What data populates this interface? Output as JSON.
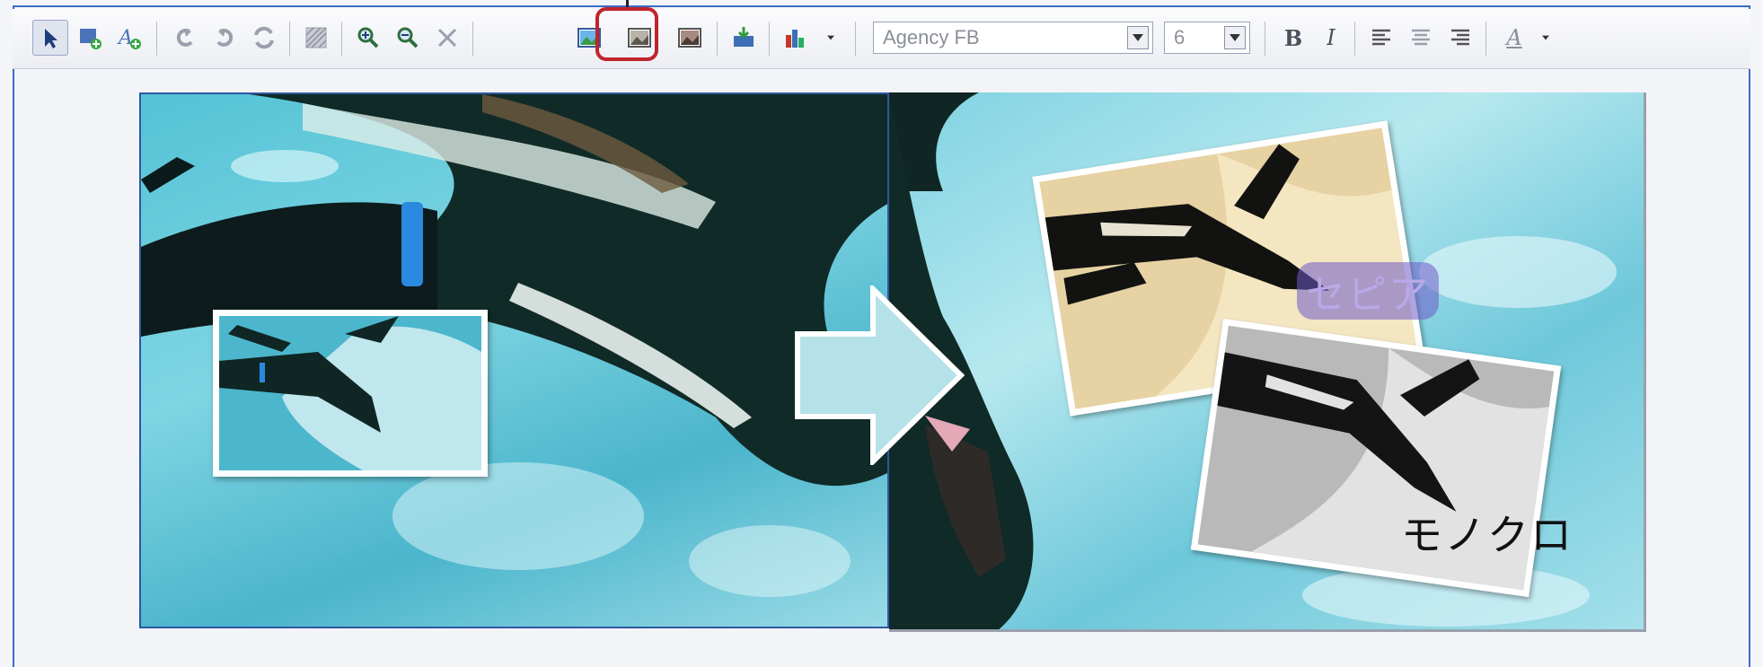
{
  "toolbar": {
    "font_name": "Agency FB",
    "font_size": "6",
    "bold_label": "B",
    "italic_label": "I",
    "font_color_label": "A",
    "icons": [
      "pointer-icon",
      "insert-image-icon",
      "insert-text-icon",
      "undo-icon",
      "redo-icon",
      "refresh-icon",
      "hatch-icon",
      "zoom-in-icon",
      "zoom-out-icon",
      "fit-icon",
      "color-image-icon",
      "sepia-image-icon",
      "mono-image-icon",
      "import-icon",
      "chart-icon",
      "align-left-icon",
      "align-center-icon",
      "align-right-icon"
    ]
  },
  "canvas": {
    "sepia_label": "セピア",
    "mono_label": "モノクロ"
  },
  "colors": {
    "highlight": "#c0242b",
    "frame_border": "#3a6dc8",
    "water": "#5ec6d9"
  }
}
